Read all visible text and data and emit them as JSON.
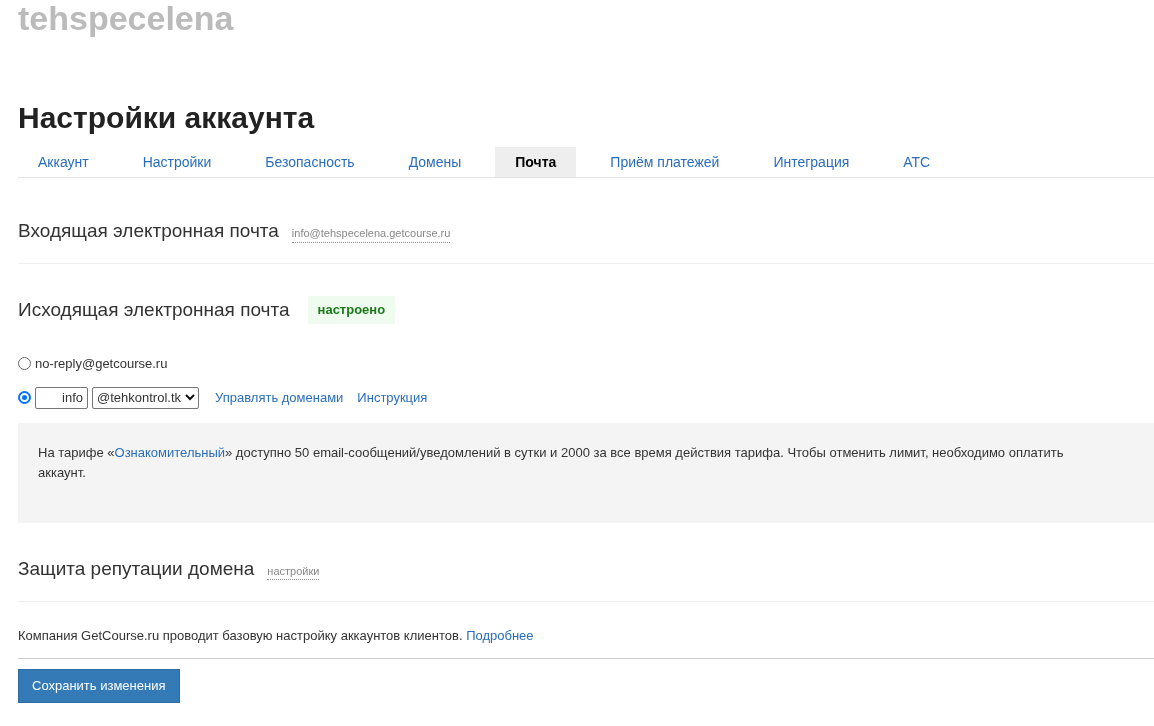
{
  "site_name": "tehspecelena",
  "page_title": "Настройки аккаунта",
  "tabs": [
    {
      "label": "Аккаунт",
      "selected": false
    },
    {
      "label": "Настройки",
      "selected": false
    },
    {
      "label": "Безопасность",
      "selected": false
    },
    {
      "label": "Домены",
      "selected": false
    },
    {
      "label": "Почта",
      "selected": true
    },
    {
      "label": "Приём платежей",
      "selected": false
    },
    {
      "label": "Интеграция",
      "selected": false
    },
    {
      "label": "АТС",
      "selected": false
    }
  ],
  "incoming": {
    "title": "Входящая электронная почта",
    "address": "info@tehspecelena.getcourse.ru"
  },
  "outgoing": {
    "title": "Исходящая электронная почта",
    "status": "настроено",
    "options": [
      {
        "kind": "fixed",
        "selected": false,
        "label": "no-reply@getcourse.ru"
      },
      {
        "kind": "custom",
        "selected": true,
        "local_part": "info",
        "domain": "@tehkontrol.tk",
        "links": [
          "Управлять доменами",
          "Инструкция"
        ]
      }
    ]
  },
  "notice": {
    "before": "На тарифе «",
    "link": "Ознакомительный",
    "after": "» доступно 50 email-сообщений/уведомлений в сутки и 2000 за все время действия тарифа. Чтобы отменить лимит, необходимо оплатить аккаунт."
  },
  "protection": {
    "title": "Защита репутации домена",
    "link": "настройки"
  },
  "footer_note": {
    "text": "Компания GetCourse.ru проводит базовую настройку аккаунтов клиентов.",
    "link": "Подробнее"
  },
  "save_button": "Сохранить изменения"
}
